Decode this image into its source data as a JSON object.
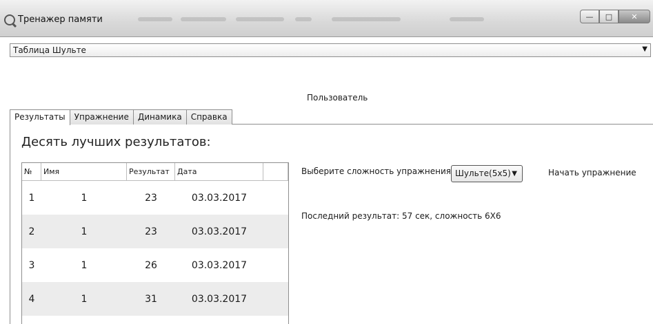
{
  "window": {
    "title": "Тренажер памяти"
  },
  "selector": {
    "value": "Таблица Шульте"
  },
  "user_label": "Пользователь",
  "tabs": [
    {
      "label": "Результаты",
      "active": true
    },
    {
      "label": "Упражнение",
      "active": false
    },
    {
      "label": "Динамика",
      "active": false
    },
    {
      "label": "Справка",
      "active": false
    }
  ],
  "heading": "Десять лучших результатов:",
  "table": {
    "headers": [
      "№",
      "Имя",
      "Результат",
      "Дата"
    ],
    "rows": [
      [
        "1",
        "1",
        "23",
        "03.03.2017"
      ],
      [
        "2",
        "1",
        "23",
        "03.03.2017"
      ],
      [
        "3",
        "1",
        "26",
        "03.03.2017"
      ],
      [
        "4",
        "1",
        "31",
        "03.03.2017"
      ]
    ]
  },
  "difficulty": {
    "label": "Выберите сложность упражнения:",
    "selected": "Шульте(5x5)"
  },
  "start_label": "Начать упражнение",
  "last_result": "Последний результат: 57 сек, сложность 6Х6"
}
